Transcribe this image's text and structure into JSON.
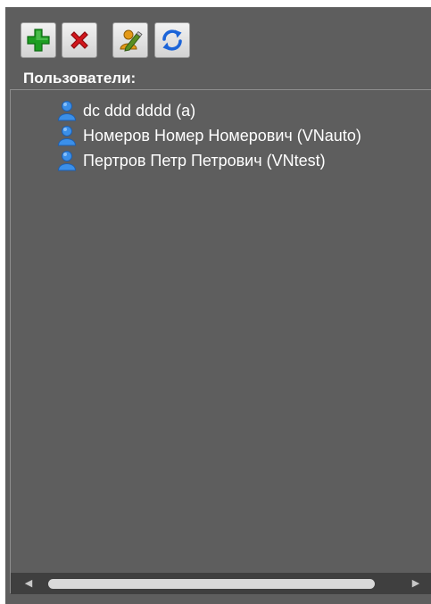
{
  "toolbar": {
    "buttons": [
      {
        "name": "add-user-button",
        "icon": "plus-icon",
        "color": "#1e9e22"
      },
      {
        "name": "delete-user-button",
        "icon": "x-icon",
        "color": "#d3161c"
      },
      {
        "name": "edit-user-button",
        "icon": "edit-user-icon",
        "color": "#e49a18"
      },
      {
        "name": "refresh-button",
        "icon": "refresh-icon",
        "color": "#1b64d8"
      }
    ]
  },
  "users_label": "Пользователи:",
  "users": [
    {
      "label": "dc ddd dddd (a)",
      "icon": "user-icon"
    },
    {
      "label": "Номеров Номер Номерович (VNauto)",
      "icon": "user-icon"
    },
    {
      "label": "Пертров Петр Петрович (VNtest)",
      "icon": "user-icon"
    }
  ],
  "scrollbar": {
    "left_arrow": "◀",
    "right_arrow": "▶"
  },
  "colors": {
    "panel_bg": "#5e5e5e",
    "user_icon": "#3b8fe8",
    "text": "#ffffff"
  }
}
